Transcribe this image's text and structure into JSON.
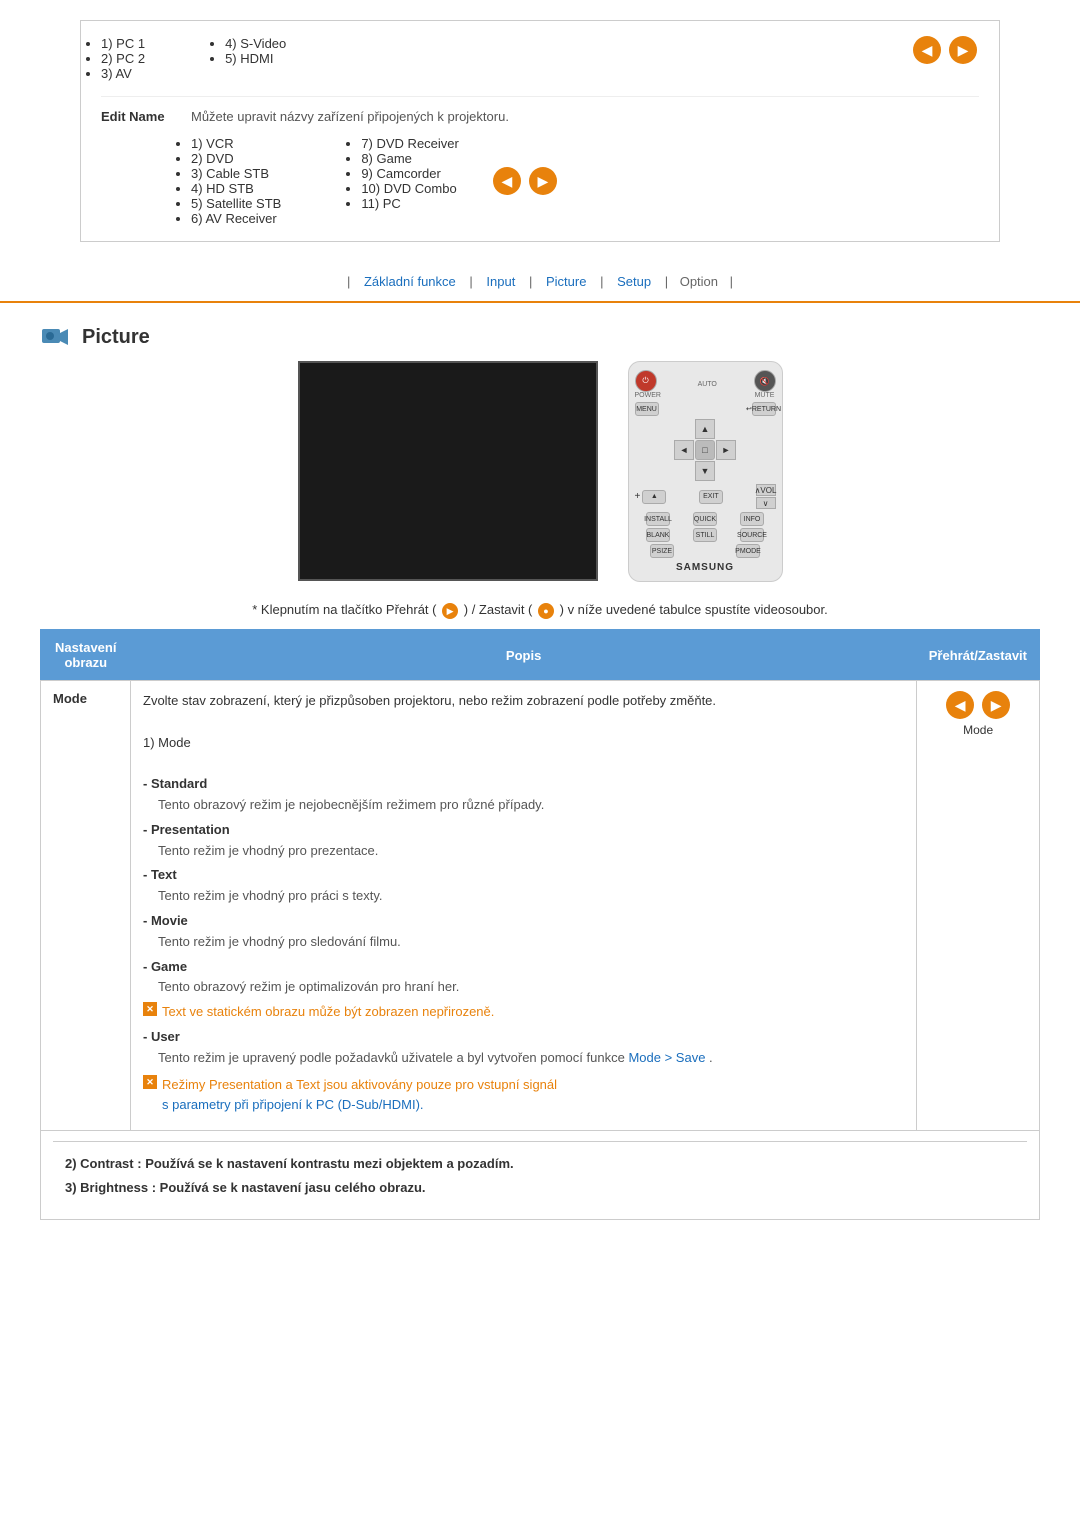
{
  "top_section": {
    "inputs_col1": [
      "1) PC 1",
      "2) PC 2",
      "3) AV"
    ],
    "inputs_col2": [
      "4) S-Video",
      "5) HDMI"
    ],
    "edit_name_label": "Edit Name",
    "edit_name_desc": "Můžete upravit názvy zařízení připojených k projektoru.",
    "devices_col1": [
      "1) VCR",
      "2) DVD",
      "3) Cable STB",
      "4) HD STB",
      "5) Satellite STB",
      "6) AV Receiver"
    ],
    "devices_col2": [
      "7) DVD Receiver",
      "8) Game",
      "9) Camcorder",
      "10) DVD Combo",
      "11) PC"
    ]
  },
  "nav": {
    "separator": "|",
    "links": [
      "Základní funkce",
      "Input",
      "Picture",
      "Setup",
      "Option"
    ],
    "current": "Option"
  },
  "picture_section": {
    "title": "Picture",
    "play_note": "* Klepnutím na tlačítko Přehrát (",
    "play_note_mid": ") / Zastavit (",
    "play_note_end": ") v níže uvedené tabulce spustíte videosoubor."
  },
  "table": {
    "headers": [
      "Nastavení obrazu",
      "Popis",
      "Přehrát/Zastavit"
    ],
    "rows": [
      {
        "setting": "Mode",
        "description_intro": "Zvolte stav zobrazení, který je přizpůsoben projektoru, nebo režim zobrazení podle potřeby změňte.",
        "mode_label": "1) Mode",
        "modes": [
          {
            "name": "- Standard",
            "desc": "Tento obrazový režim je nejobecnějším režimem pro různé případy."
          },
          {
            "name": "- Presentation",
            "desc": "Tento režim je vhodný pro prezentace."
          },
          {
            "name": "- Text",
            "desc": "Tento režim je vhodný pro práci s texty."
          },
          {
            "name": "- Movie",
            "desc": "Tento režim je vhodný pro sledování filmu."
          },
          {
            "name": "- Game",
            "desc": "Tento obrazový režim je optimalizován pro hraní her."
          }
        ],
        "warning1": "Text ve statickém obrazu může být zobrazen nepřirozeně.",
        "mode_user_label": "- User",
        "mode_user_desc": "Tento režim je upravený podle požadavků uživatele a byl vytvořen pomocí funkce",
        "mode_save_link": "Mode > Save",
        "mode_save_end": ".",
        "warning2_line1": "Režimy Presentation a Text jsou aktivovány pouze pro vstupní signál",
        "warning2_line2": "s parametry při připojení k PC (D-Sub/HDMI).",
        "arrows_label": "Mode"
      }
    ],
    "bottom_notes": [
      "2) Contrast: Používá se k nastavení kontrastu mezi objektem a pozadím.",
      "3) Brightness: Používá se k nastavení jasu celého obrazu."
    ]
  },
  "icons": {
    "prev_arrow": "◀",
    "next_arrow": "▶",
    "play_circle": "▶",
    "stop_circle": "●",
    "warning_x": "✕"
  }
}
